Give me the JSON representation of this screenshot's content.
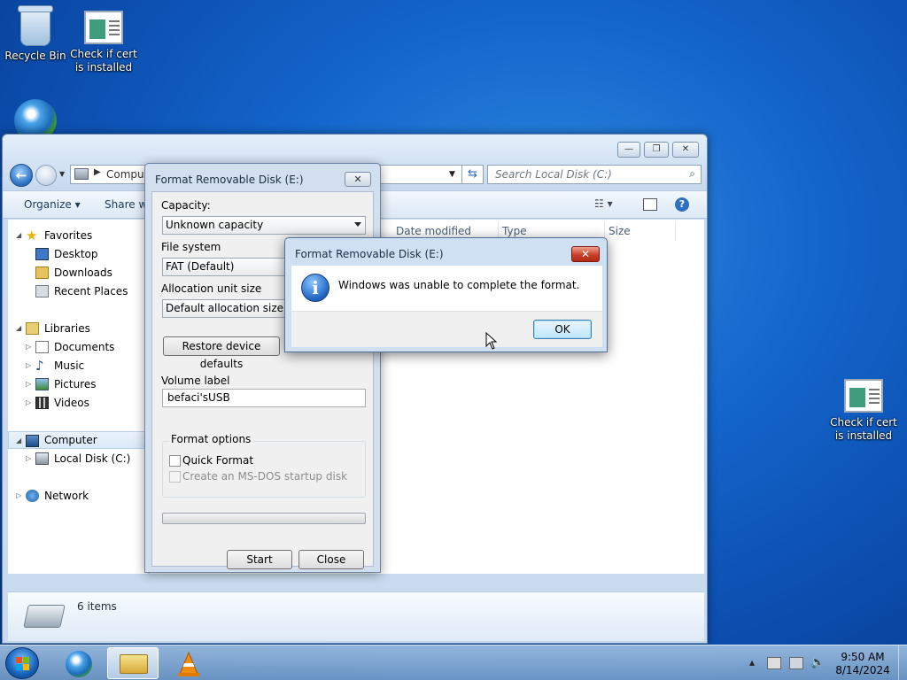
{
  "desktop": {
    "icons": [
      {
        "label": "Recycle Bin"
      },
      {
        "label": "Check if cert is installed"
      },
      {
        "label": "Check if cert is installed"
      }
    ]
  },
  "explorer": {
    "address": "Comput",
    "search_placeholder": "Search Local Disk (C:)",
    "toolbar": {
      "organize": "Organize",
      "share": "Share wit"
    },
    "nav": {
      "favorites": "Favorites",
      "desktop": "Desktop",
      "downloads": "Downloads",
      "recent": "Recent Places",
      "libraries": "Libraries",
      "documents": "Documents",
      "music": "Music",
      "pictures": "Pictures",
      "videos": "Videos",
      "computer": "Computer",
      "local_disk": "Local Disk (C:)",
      "network": "Network"
    },
    "columns": {
      "date": "Date modified",
      "type": "Type",
      "size": "Size"
    },
    "status": "6 items"
  },
  "format_dialog": {
    "title": "Format Removable Disk (E:)",
    "capacity_label": "Capacity:",
    "capacity_value": "Unknown capacity",
    "fs_label": "File system",
    "fs_value": "FAT (Default)",
    "alloc_label": "Allocation unit size",
    "alloc_value": "Default allocation size",
    "restore_button": "Restore device defaults",
    "volume_label": "Volume label",
    "volume_value": "befaci'sUSB",
    "options_label": "Format options",
    "quick_format": "Quick Format",
    "msdos": "Create an MS-DOS startup disk",
    "start": "Start",
    "close": "Close"
  },
  "message_box": {
    "title": "Format Removable Disk (E:)",
    "text": "Windows was unable to complete the format.",
    "ok": "OK"
  },
  "taskbar": {
    "time": "9:50 AM",
    "date": "8/14/2024"
  }
}
